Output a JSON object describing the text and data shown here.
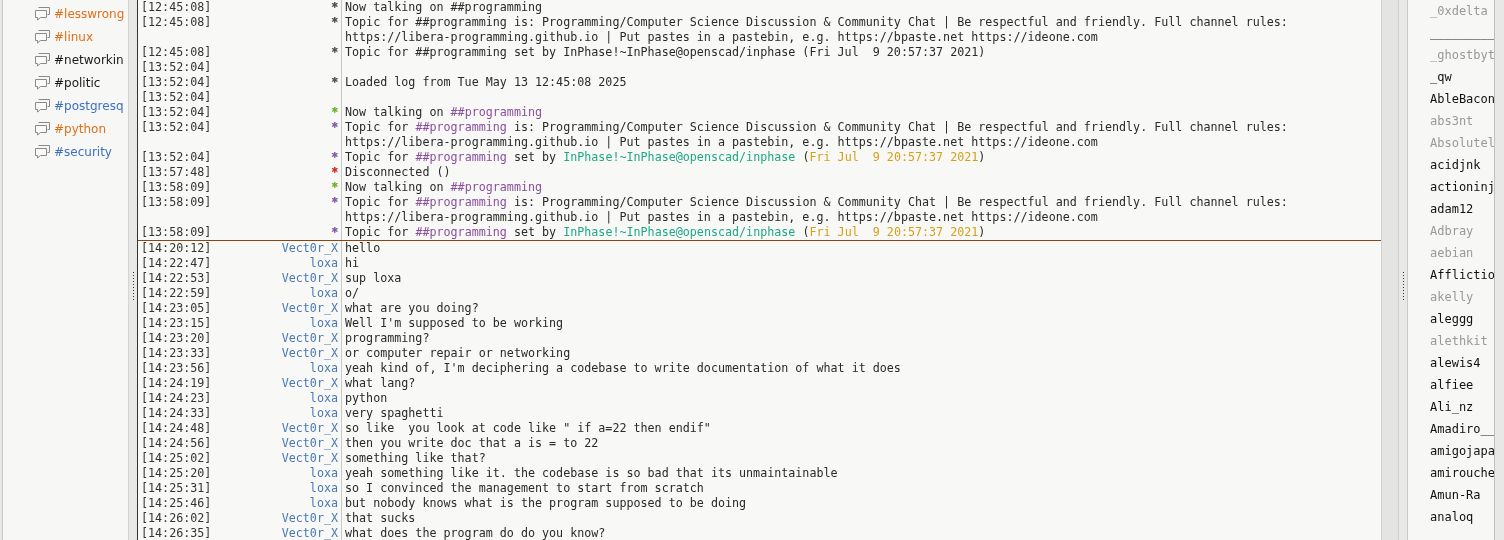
{
  "sidebar": {
    "channels": [
      {
        "name": "#lesswrong",
        "color": "#e0701a"
      },
      {
        "name": "#linux",
        "color": "#e0701a"
      },
      {
        "name": "#networkin",
        "color": "#1a1a1a"
      },
      {
        "name": "#politic",
        "color": "#1a1a1a"
      },
      {
        "name": "#postgresq",
        "color": "#3f6fc0"
      },
      {
        "name": "#python",
        "color": "#e0701a"
      },
      {
        "name": "#security",
        "color": "#3f6fc0"
      }
    ]
  },
  "chat": {
    "history": [
      {
        "time": "[12:45:08]",
        "nick": "*",
        "color": "#555555",
        "segments": [
          {
            "text": "Now talking on ##programming",
            "kind": "plain"
          }
        ]
      },
      {
        "time": "[12:45:08]",
        "nick": "*",
        "color": "#555555",
        "segments": [
          {
            "text": "Topic for ##programming is: Programming/Computer Science Discussion & Community Chat | Be respectful and friendly. Full channel rules: https://libera-programming.github.io | Put pastes in a pastebin, e.g. https://bpaste.net https://ideone.com",
            "kind": "plain"
          }
        ]
      },
      {
        "time": "[12:45:08]",
        "nick": "*",
        "color": "#555555",
        "segments": [
          {
            "text": "Topic for ##programming set by InPhase!~InPhase@openscad/inphase (Fri Jul  9 20:57:37 2021)",
            "kind": "plain"
          }
        ]
      },
      {
        "time": "[13:52:04]"
      },
      {
        "time": "[13:52:04]",
        "nick": "*",
        "color": "#555555",
        "segments": [
          {
            "text": "Loaded log from Tue May 13 12:45:08 2025",
            "kind": "plain"
          }
        ]
      },
      {
        "time": "[13:52:04]"
      },
      {
        "time": "[13:52:04]",
        "nick": "*",
        "color": "#73b22c",
        "segments": [
          {
            "text": "Now talking on ",
            "kind": "plain"
          },
          {
            "text": "##programming",
            "kind": "channel"
          }
        ]
      },
      {
        "time": "[13:52:04]",
        "nick": "*",
        "color": "#8a5ba8",
        "segments": [
          {
            "text": "Topic for ",
            "kind": "plain"
          },
          {
            "text": "##programming",
            "kind": "channel"
          },
          {
            "text": " is: Programming/Computer Science Discussion & Community Chat | Be respectful and friendly. Full channel rules: https://libera-programming.github.io | Put pastes in a pastebin, e.g. https://bpaste.net https://ideone.com",
            "kind": "plain"
          }
        ]
      },
      {
        "time": "[13:52:04]",
        "nick": "*",
        "color": "#8a5ba8",
        "segments": [
          {
            "text": "Topic for ",
            "kind": "plain"
          },
          {
            "text": "##programming",
            "kind": "channel"
          },
          {
            "text": " set by ",
            "kind": "plain"
          },
          {
            "text": "InPhase!~InPhase@openscad/inphase",
            "kind": "nick"
          },
          {
            "text": " (",
            "kind": "plain"
          },
          {
            "text": "Fri Jul  9 20:57:37 2021",
            "kind": "date"
          },
          {
            "text": ")",
            "kind": "plain"
          }
        ]
      },
      {
        "time": "[13:57:48]",
        "nick": "*",
        "color": "#d0302a",
        "segments": [
          {
            "text": "Disconnected ()",
            "kind": "plain"
          }
        ]
      },
      {
        "time": "[13:58:09]",
        "nick": "*",
        "color": "#73b22c",
        "segments": [
          {
            "text": "Now talking on ",
            "kind": "plain"
          },
          {
            "text": "##programming",
            "kind": "channel"
          }
        ]
      },
      {
        "time": "[13:58:09]",
        "nick": "*",
        "color": "#8a5ba8",
        "segments": [
          {
            "text": "Topic for ",
            "kind": "plain"
          },
          {
            "text": "##programming",
            "kind": "channel"
          },
          {
            "text": " is: Programming/Computer Science Discussion & Community Chat | Be respectful and friendly. Full channel rules: https://libera-programming.github.io | Put pastes in a pastebin, e.g. https://bpaste.net https://ideone.com",
            "kind": "plain"
          }
        ]
      },
      {
        "time": "[13:58:09]",
        "nick": "*",
        "color": "#8a5ba8",
        "segments": [
          {
            "text": "Topic for ",
            "kind": "plain"
          },
          {
            "text": "##programming",
            "kind": "channel"
          },
          {
            "text": " set by ",
            "kind": "plain"
          },
          {
            "text": "InPhase!~InPhase@openscad/inphase",
            "kind": "nick"
          },
          {
            "text": " (",
            "kind": "plain"
          },
          {
            "text": "Fri Jul  9 20:57:37 2021",
            "kind": "date"
          },
          {
            "text": ")",
            "kind": "plain"
          }
        ]
      }
    ],
    "messages": [
      {
        "time": "[14:20:12]",
        "nick": "Vect0r_X",
        "text": "hello"
      },
      {
        "time": "[14:22:47]",
        "nick": "loxa",
        "text": "hi"
      },
      {
        "time": "[14:22:53]",
        "nick": "Vect0r_X",
        "text": "sup loxa"
      },
      {
        "time": "[14:22:59]",
        "nick": "loxa",
        "text": "o/"
      },
      {
        "time": "[14:23:05]",
        "nick": "Vect0r_X",
        "text": "what are you doing?"
      },
      {
        "time": "[14:23:15]",
        "nick": "loxa",
        "text": "Well I'm supposed to be working"
      },
      {
        "time": "[14:23:20]",
        "nick": "Vect0r_X",
        "text": "programming?"
      },
      {
        "time": "[14:23:33]",
        "nick": "Vect0r_X",
        "text": "or computer repair or networking"
      },
      {
        "time": "[14:23:56]",
        "nick": "loxa",
        "text": "yeah kind of, I'm deciphering a codebase to write documentation of what it does"
      },
      {
        "time": "[14:24:19]",
        "nick": "Vect0r_X",
        "text": "what lang?"
      },
      {
        "time": "[14:24:23]",
        "nick": "loxa",
        "text": "python"
      },
      {
        "time": "[14:24:33]",
        "nick": "loxa",
        "text": "very spaghetti"
      },
      {
        "time": "[14:24:48]",
        "nick": "Vect0r_X",
        "text": "so like  you look at code like \" if a=22 then endif\""
      },
      {
        "time": "[14:24:56]",
        "nick": "Vect0r_X",
        "text": "then you write doc that a is = to 22"
      },
      {
        "time": "[14:25:02]",
        "nick": "Vect0r_X",
        "text": "something like that?"
      },
      {
        "time": "[14:25:20]",
        "nick": "loxa",
        "text": "yeah something like it. the codebase is so bad that its unmaintainable"
      },
      {
        "time": "[14:25:31]",
        "nick": "loxa",
        "text": "so I convinced the management to start from scratch"
      },
      {
        "time": "[14:25:46]",
        "nick": "loxa",
        "text": "but nobody knows what is the program supposed to be doing"
      },
      {
        "time": "[14:26:02]",
        "nick": "Vect0r_X",
        "text": "that sucks"
      },
      {
        "time": "[14:26:35]",
        "nick": "Vect0r_X",
        "text": "what does the program do do you know?"
      }
    ]
  },
  "userlist": {
    "users": [
      {
        "name": "_0xdelta",
        "away": true
      },
      {
        "name": "_________",
        "away": false
      },
      {
        "name": "_ghostbyt",
        "away": true
      },
      {
        "name": "_qw",
        "away": false
      },
      {
        "name": "AbleBacon",
        "away": false
      },
      {
        "name": "abs3nt",
        "away": true
      },
      {
        "name": "Absolutel",
        "away": true
      },
      {
        "name": "acidjnk",
        "away": false
      },
      {
        "name": "actioninj",
        "away": false
      },
      {
        "name": "adam12",
        "away": false
      },
      {
        "name": "Adbray",
        "away": true
      },
      {
        "name": "aebian",
        "away": true
      },
      {
        "name": "Afflictio",
        "away": false
      },
      {
        "name": "akelly",
        "away": true
      },
      {
        "name": "aleggg",
        "away": false
      },
      {
        "name": "alethkit",
        "away": true
      },
      {
        "name": "alewis4",
        "away": false
      },
      {
        "name": "alfiee",
        "away": false
      },
      {
        "name": "Ali_nz",
        "away": false
      },
      {
        "name": "Amadiro__",
        "away": false
      },
      {
        "name": "amigojapa",
        "away": false
      },
      {
        "name": "amirouche",
        "away": false
      },
      {
        "name": "Amun-Ra",
        "away": false
      },
      {
        "name": "analoq",
        "away": false
      }
    ]
  }
}
